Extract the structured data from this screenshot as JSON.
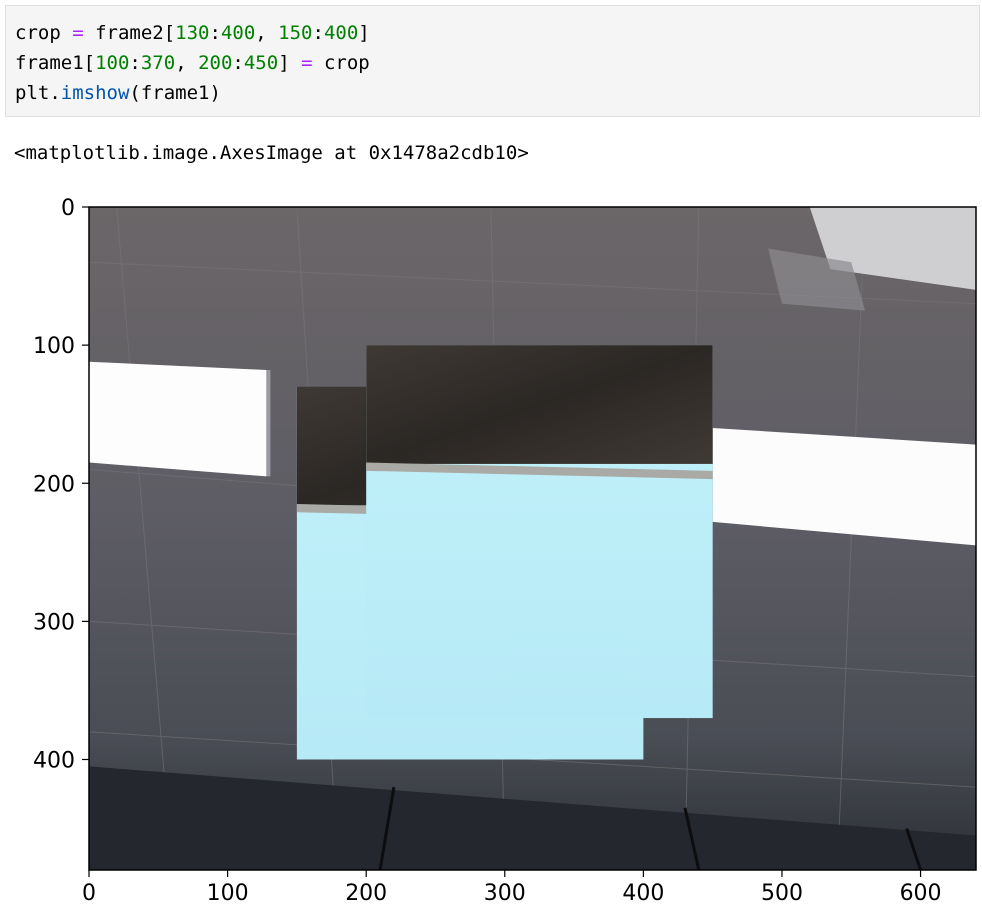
{
  "code_cell": {
    "line1": {
      "a": "crop ",
      "op": "=",
      "b": " frame2[",
      "n1": "130",
      "c1": ":",
      "n2": "400",
      "c2": ", ",
      "n3": "150",
      "c3": ":",
      "n4": "400",
      "d": "]"
    },
    "line2": {
      "a": "frame1[",
      "n1": "100",
      "c1": ":",
      "n2": "370",
      "c2": ", ",
      "n3": "200",
      "c3": ":",
      "n4": "450",
      "b": "] ",
      "op": "=",
      "d": " crop"
    },
    "line3": {
      "a": "plt.",
      "fn": "imshow",
      "b": "(frame1)"
    }
  },
  "output_text": "<matplotlib.image.AxesImage at 0x1478a2cdb10>",
  "chart_data": {
    "type": "image",
    "image_width": 640,
    "image_height": 480,
    "xticks": [
      0,
      100,
      200,
      300,
      400,
      500,
      600
    ],
    "yticks": [
      0,
      100,
      200,
      300,
      400
    ],
    "xtick_labels": [
      "0",
      "100",
      "200",
      "300",
      "400",
      "500",
      "600"
    ],
    "ytick_labels": [
      "0",
      "100",
      "200",
      "300",
      "400"
    ],
    "regions": [
      {
        "name": "ceiling-background",
        "x": [
          0,
          640
        ],
        "y": [
          0,
          480
        ],
        "color": "#5c5a60"
      },
      {
        "name": "light-panel-left",
        "x": [
          0,
          128
        ],
        "y": [
          112,
          195
        ],
        "color": "#fdfdfd"
      },
      {
        "name": "light-panel-right",
        "x": [
          450,
          640
        ],
        "y": [
          160,
          250
        ],
        "color": "#fcfcfc"
      },
      {
        "name": "crop-paste-1",
        "x": [
          150,
          400
        ],
        "y": [
          130,
          400
        ],
        "color": "#bdeff8"
      },
      {
        "name": "crop-paste-2",
        "x": [
          200,
          450
        ],
        "y": [
          100,
          370
        ],
        "color": "#beeff9"
      }
    ]
  }
}
